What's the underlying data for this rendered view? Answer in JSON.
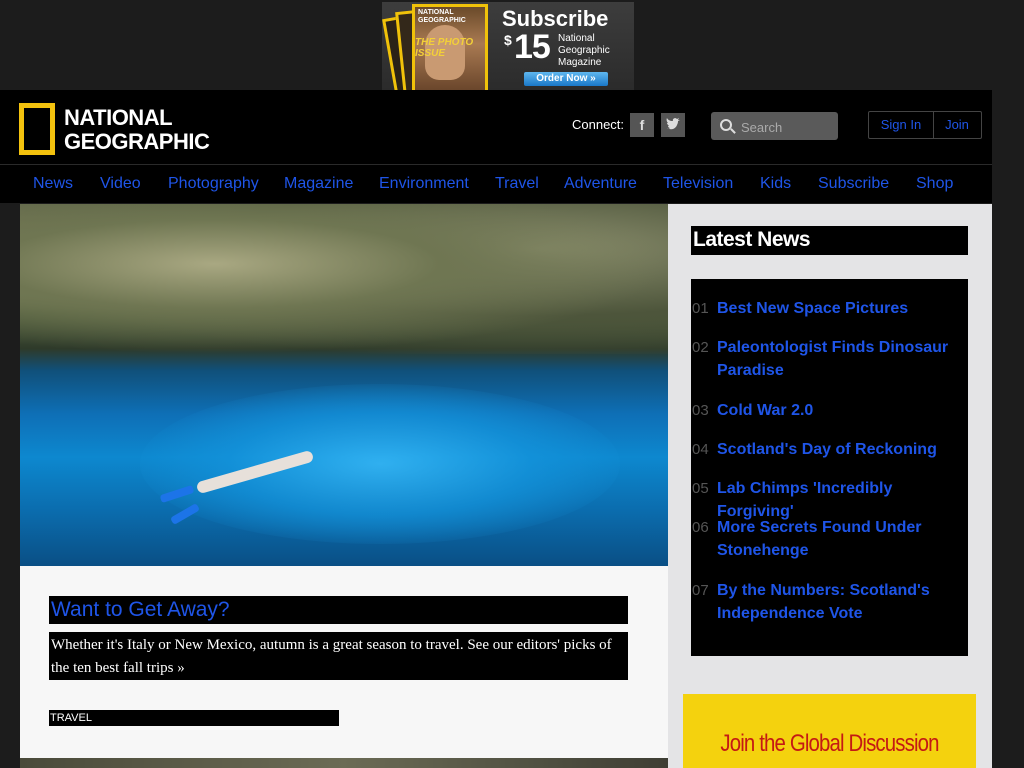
{
  "ad": {
    "magazine_title": "NATIONAL GEOGRAPHIC",
    "magazine_issue": "THE PHOTO ISSUE",
    "title": "Subscribe",
    "dollar": "$",
    "price": "15",
    "description": "National Geographic Magazine",
    "cta": "Order Now »"
  },
  "header": {
    "logo_line1": "NATIONAL",
    "logo_line2": "GEOGRAPHIC",
    "connect_label": "Connect:",
    "facebook": "f",
    "twitter": "t",
    "search_placeholder": "Search",
    "sign_in": "Sign In",
    "join": "Join"
  },
  "nav": [
    "News",
    "Video",
    "Photography",
    "Magazine",
    "Environment",
    "Travel",
    "Adventure",
    "Television",
    "Kids",
    "Subscribe",
    "Shop"
  ],
  "feature": {
    "title": "Want to Get Away?",
    "description": "Whether it's Italy or New Mexico, autumn is a great season to travel. See our editors' picks of the ten best fall trips »",
    "tag": "TRAVEL"
  },
  "sidebar": {
    "latest_title": "Latest News",
    "news": [
      {
        "num": "01",
        "title": "Best New Space Pictures"
      },
      {
        "num": "02",
        "title": "Paleontologist Finds Dinosaur Paradise"
      },
      {
        "num": "03",
        "title": "Cold War 2.0"
      },
      {
        "num": "04",
        "title": "Scotland's Day of Reckoning"
      },
      {
        "num": "05",
        "title": "Lab Chimps 'Incredibly Forgiving'"
      },
      {
        "num": "06",
        "title": "More Secrets Found Under Stonehenge"
      },
      {
        "num": "07",
        "title": "By the Numbers: Scotland's Independence Vote"
      }
    ],
    "discussion": "Join the Global Discussion"
  },
  "colors": {
    "link": "#1f55e8",
    "logo_yellow": "#f3c20e",
    "banner_yellow": "#f4d20e",
    "discussion_red": "#c41a14"
  }
}
